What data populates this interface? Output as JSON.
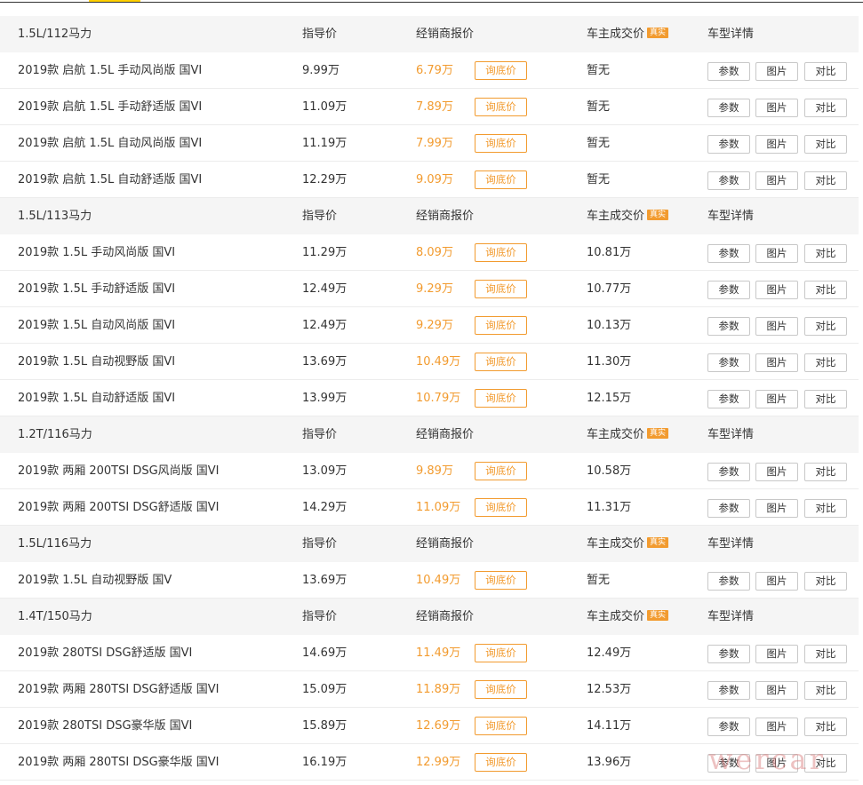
{
  "colors": {
    "accent": "#f29b2f",
    "brand": "#ffd000"
  },
  "labels": {
    "guide_price": "指导价",
    "dealer_price": "经销商报价",
    "owner_price": "车主成交价",
    "real_badge": "真实",
    "detail": "车型详情",
    "ask_price": "询底价",
    "params": "参数",
    "photos": "图片",
    "compare": "对比"
  },
  "groups": [
    {
      "engine": "1.5L/112马力",
      "models": [
        {
          "name": "2019款 启航 1.5L 手动风尚版 国VI",
          "guide": "9.99万",
          "dealer": "6.79万",
          "owner": "暂无"
        },
        {
          "name": "2019款 启航 1.5L 手动舒适版 国VI",
          "guide": "11.09万",
          "dealer": "7.89万",
          "owner": "暂无"
        },
        {
          "name": "2019款 启航 1.5L 自动风尚版 国VI",
          "guide": "11.19万",
          "dealer": "7.99万",
          "owner": "暂无"
        },
        {
          "name": "2019款 启航 1.5L 自动舒适版 国VI",
          "guide": "12.29万",
          "dealer": "9.09万",
          "owner": "暂无"
        }
      ]
    },
    {
      "engine": "1.5L/113马力",
      "models": [
        {
          "name": "2019款 1.5L 手动风尚版 国VI",
          "guide": "11.29万",
          "dealer": "8.09万",
          "owner": "10.81万"
        },
        {
          "name": "2019款 1.5L 手动舒适版 国VI",
          "guide": "12.49万",
          "dealer": "9.29万",
          "owner": "10.77万"
        },
        {
          "name": "2019款 1.5L 自动风尚版 国VI",
          "guide": "12.49万",
          "dealer": "9.29万",
          "owner": "10.13万"
        },
        {
          "name": "2019款 1.5L 自动视野版 国VI",
          "guide": "13.69万",
          "dealer": "10.49万",
          "owner": "11.30万"
        },
        {
          "name": "2019款 1.5L 自动舒适版 国VI",
          "guide": "13.99万",
          "dealer": "10.79万",
          "owner": "12.15万"
        }
      ]
    },
    {
      "engine": "1.2T/116马力",
      "models": [
        {
          "name": "2019款 两厢 200TSI DSG风尚版 国VI",
          "guide": "13.09万",
          "dealer": "9.89万",
          "owner": "10.58万"
        },
        {
          "name": "2019款 两厢 200TSI DSG舒适版 国VI",
          "guide": "14.29万",
          "dealer": "11.09万",
          "owner": "11.31万"
        }
      ]
    },
    {
      "engine": "1.5L/116马力",
      "models": [
        {
          "name": "2019款 1.5L 自动视野版 国V",
          "guide": "13.69万",
          "dealer": "10.49万",
          "owner": "暂无"
        }
      ]
    },
    {
      "engine": "1.4T/150马力",
      "models": [
        {
          "name": "2019款 280TSI DSG舒适版 国VI",
          "guide": "14.69万",
          "dealer": "11.49万",
          "owner": "12.49万"
        },
        {
          "name": "2019款 两厢 280TSI DSG舒适版 国VI",
          "guide": "15.09万",
          "dealer": "11.89万",
          "owner": "12.53万"
        },
        {
          "name": "2019款 280TSI DSG豪华版 国VI",
          "guide": "15.89万",
          "dealer": "12.69万",
          "owner": "14.11万"
        },
        {
          "name": "2019款 两厢 280TSI DSG豪华版 国VI",
          "guide": "16.19万",
          "dealer": "12.99万",
          "owner": "13.96万"
        }
      ]
    }
  ],
  "watermark": "wercar"
}
